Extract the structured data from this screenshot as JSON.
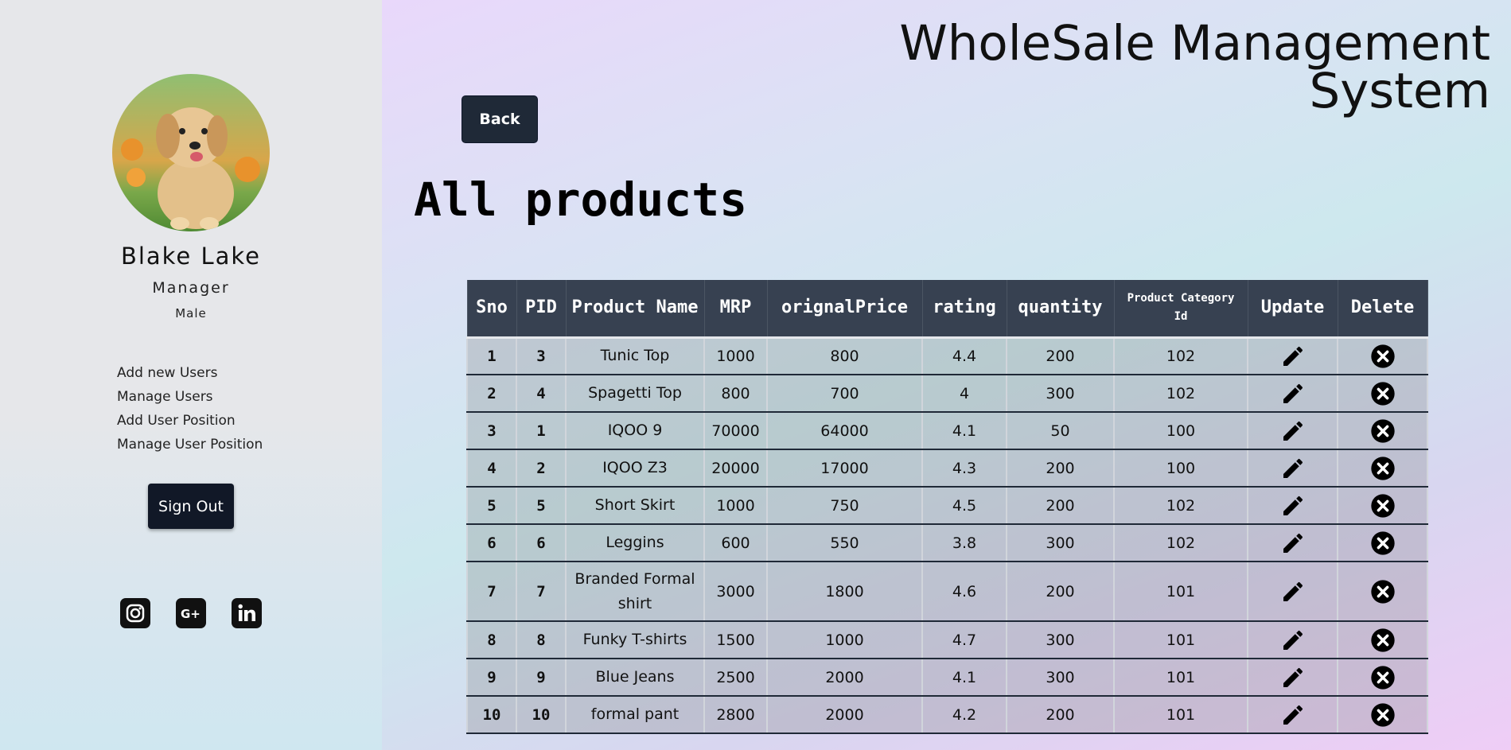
{
  "app": {
    "title": "WholeSale Management System"
  },
  "user": {
    "name": "Blake Lake",
    "role": "Manager",
    "gender": "Male"
  },
  "menu": [
    "Add new Users",
    "Manage Users",
    "Add User Position",
    "Manage User Position"
  ],
  "sidebar": {
    "signout_label": "Sign Out"
  },
  "social": [
    "instagram-icon",
    "google-plus-icon",
    "linkedin-icon"
  ],
  "main": {
    "back_label": "Back",
    "page_title": "All products"
  },
  "table": {
    "headers": {
      "sno": "Sno",
      "pid": "PID",
      "name": "Product Name",
      "mrp": "MRP",
      "original": "orignalPrice",
      "rating": "rating",
      "quantity": "quantity",
      "category": "Product Category Id",
      "update": "Update",
      "delete": "Delete"
    },
    "rows": [
      {
        "sno": "1",
        "pid": "3",
        "name": "Tunic Top",
        "mrp": "1000",
        "original": "800",
        "rating": "4.4",
        "quantity": "200",
        "category": "102"
      },
      {
        "sno": "2",
        "pid": "4",
        "name": "Spagetti Top",
        "mrp": "800",
        "original": "700",
        "rating": "4",
        "quantity": "300",
        "category": "102"
      },
      {
        "sno": "3",
        "pid": "1",
        "name": "IQOO 9",
        "mrp": "70000",
        "original": "64000",
        "rating": "4.1",
        "quantity": "50",
        "category": "100"
      },
      {
        "sno": "4",
        "pid": "2",
        "name": "IQOO Z3",
        "mrp": "20000",
        "original": "17000",
        "rating": "4.3",
        "quantity": "200",
        "category": "100"
      },
      {
        "sno": "5",
        "pid": "5",
        "name": "Short Skirt",
        "mrp": "1000",
        "original": "750",
        "rating": "4.5",
        "quantity": "200",
        "category": "102"
      },
      {
        "sno": "6",
        "pid": "6",
        "name": "Leggins",
        "mrp": "600",
        "original": "550",
        "rating": "3.8",
        "quantity": "300",
        "category": "102"
      },
      {
        "sno": "7",
        "pid": "7",
        "name": "Branded Formal shirt",
        "mrp": "3000",
        "original": "1800",
        "rating": "4.6",
        "quantity": "200",
        "category": "101"
      },
      {
        "sno": "8",
        "pid": "8",
        "name": "Funky T-shirts",
        "mrp": "1500",
        "original": "1000",
        "rating": "4.7",
        "quantity": "300",
        "category": "101"
      },
      {
        "sno": "9",
        "pid": "9",
        "name": "Blue Jeans",
        "mrp": "2500",
        "original": "2000",
        "rating": "4.1",
        "quantity": "300",
        "category": "101"
      },
      {
        "sno": "10",
        "pid": "10",
        "name": "formal pant",
        "mrp": "2800",
        "original": "2000",
        "rating": "4.2",
        "quantity": "200",
        "category": "101"
      }
    ]
  }
}
